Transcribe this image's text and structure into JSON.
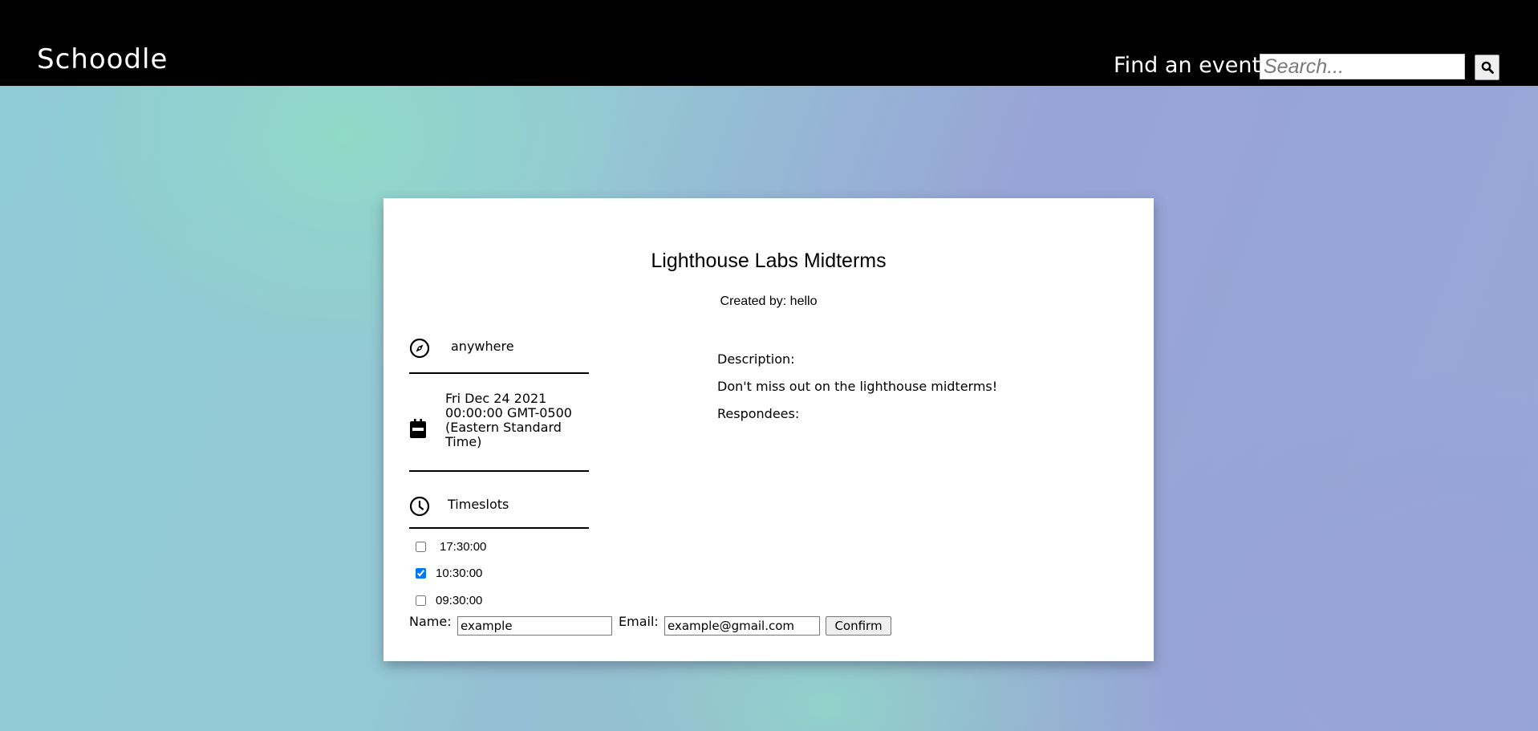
{
  "navbar": {
    "brand": "Schoodle",
    "search_label": "Find an event:",
    "search_placeholder": "Search...",
    "search_value": ""
  },
  "event": {
    "title": "Lighthouse Labs Midterms",
    "created_by": "Created by: hello",
    "location": "anywhere",
    "date": "Fri Dec 24 2021 00:00:00 GMT-0500 (Eastern Standard Time)",
    "timeslots_label": "Timeslots",
    "timeslots": [
      {
        "time": "17:30:00",
        "checked": false
      },
      {
        "time": "10:30:00",
        "checked": true
      },
      {
        "time": "09:30:00",
        "checked": false
      }
    ],
    "description_label": "Description:",
    "description": "Don't miss out on the lighthouse midterms!",
    "respondees_label": "Respondees:"
  },
  "form": {
    "name_label": "Name:",
    "name_value": "example",
    "email_label": "Email:",
    "email_value": "example@gmail.com",
    "confirm_label": "Confirm"
  },
  "colors": {
    "navbar": "#000000",
    "checkbox_accent": "#1a73e8"
  }
}
